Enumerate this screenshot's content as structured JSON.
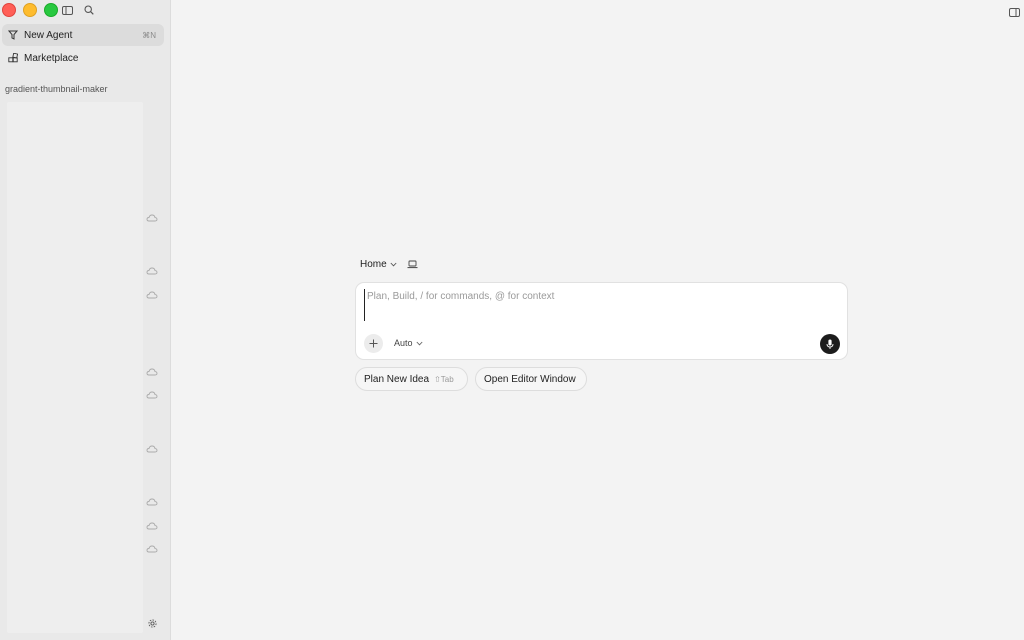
{
  "sidebar": {
    "nav": [
      {
        "label": "New Agent",
        "shortcut": "⌘N",
        "icon": "new-agent-icon"
      },
      {
        "label": "Marketplace",
        "shortcut": "",
        "icon": "marketplace-icon"
      }
    ],
    "project_label": "gradient-thumbnail-maker"
  },
  "composer": {
    "context_label": "Home",
    "placeholder": "Plan, Build, / for commands, @ for context",
    "mode": "Auto"
  },
  "actions": {
    "plan_label": "Plan New Idea",
    "plan_hint": "⇧Tab",
    "editor_label": "Open Editor Window"
  },
  "colors": {
    "accent": "#1c1c1c",
    "sidebar_bg": "#e9e9e9",
    "main_bg": "#f3f3f3"
  }
}
